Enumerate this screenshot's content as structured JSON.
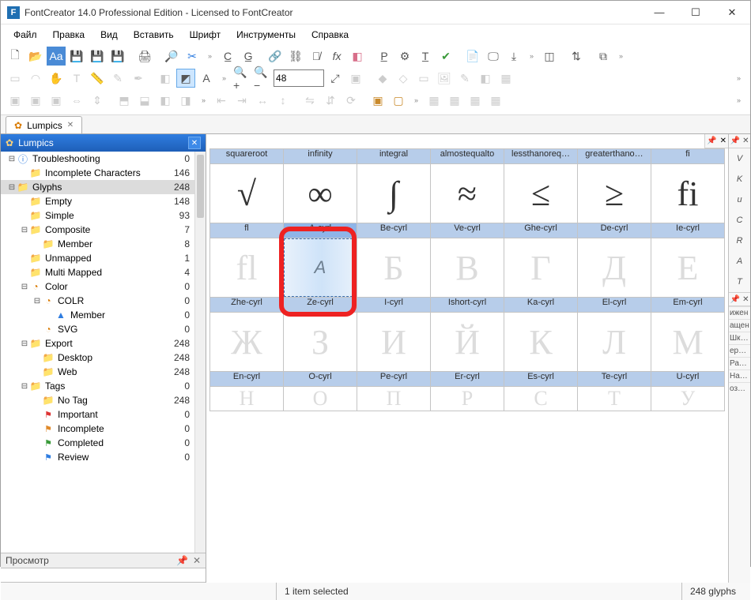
{
  "window": {
    "title": "FontCreator 14.0 Professional Edition - Licensed to FontCreator",
    "app_initial": "F"
  },
  "menu": {
    "items": [
      "Файл",
      "Правка",
      "Вид",
      "Вставить",
      "Шрифт",
      "Инструменты",
      "Справка"
    ]
  },
  "doc_tab": {
    "label": "Lumpics"
  },
  "left_panel": {
    "title": "Lumpics",
    "nodes": [
      {
        "depth": 0,
        "toggle": "-",
        "icon": "info",
        "label": "Troubleshooting",
        "count": 0
      },
      {
        "depth": 1,
        "toggle": "",
        "icon": "folder",
        "label": "Incomplete Characters",
        "count": 146
      },
      {
        "depth": 0,
        "toggle": "-",
        "icon": "folder",
        "label": "Glyphs",
        "count": 248,
        "selected": true
      },
      {
        "depth": 1,
        "toggle": "",
        "icon": "folder",
        "label": "Empty",
        "count": 148
      },
      {
        "depth": 1,
        "toggle": "",
        "icon": "folder",
        "label": "Simple",
        "count": 93
      },
      {
        "depth": 1,
        "toggle": "-",
        "icon": "folder",
        "label": "Composite",
        "count": 7
      },
      {
        "depth": 2,
        "toggle": "",
        "icon": "folder",
        "label": "Member",
        "count": 8
      },
      {
        "depth": 1,
        "toggle": "",
        "icon": "folder",
        "label": "Unmapped",
        "count": 1
      },
      {
        "depth": 1,
        "toggle": "",
        "icon": "folder",
        "label": "Multi Mapped",
        "count": 4
      },
      {
        "depth": 1,
        "toggle": "-",
        "icon": "pie",
        "label": "Color",
        "count": 0
      },
      {
        "depth": 2,
        "toggle": "-",
        "icon": "pie",
        "label": "COLR",
        "count": 0
      },
      {
        "depth": 3,
        "toggle": "",
        "icon": "tri",
        "label": "Member",
        "count": 0
      },
      {
        "depth": 2,
        "toggle": "",
        "icon": "pie",
        "label": "SVG",
        "count": 0
      },
      {
        "depth": 1,
        "toggle": "-",
        "icon": "folder",
        "label": "Export",
        "count": 248
      },
      {
        "depth": 2,
        "toggle": "",
        "icon": "folder",
        "label": "Desktop",
        "count": 248
      },
      {
        "depth": 2,
        "toggle": "",
        "icon": "folder",
        "label": "Web",
        "count": 248
      },
      {
        "depth": 1,
        "toggle": "-",
        "icon": "folder",
        "label": "Tags",
        "count": 0
      },
      {
        "depth": 2,
        "toggle": "",
        "icon": "folder",
        "label": "No Tag",
        "count": 248
      },
      {
        "depth": 2,
        "toggle": "",
        "icon": "flag-r",
        "label": "Important",
        "count": 0
      },
      {
        "depth": 2,
        "toggle": "",
        "icon": "flag-o",
        "label": "Incomplete",
        "count": 0
      },
      {
        "depth": 2,
        "toggle": "",
        "icon": "flag-g",
        "label": "Completed",
        "count": 0
      },
      {
        "depth": 2,
        "toggle": "",
        "icon": "flag-b",
        "label": "Review",
        "count": 0
      }
    ]
  },
  "grid": {
    "row1": {
      "heads": [
        "squareroot",
        "infinity",
        "integral",
        "almostequalto",
        "lessthanoreq…",
        "greaterthano…",
        "fi"
      ],
      "glyphs": [
        "√",
        "∞",
        "∫",
        "≈",
        "≤",
        "≥",
        "fi"
      ]
    },
    "row2": {
      "heads": [
        "fl",
        "A-cyrl",
        "Be-cyrl",
        "Ve-cyrl",
        "Ghe-cyrl",
        "De-cyrl",
        "Ie-cyrl"
      ],
      "glyphs": [
        "fl",
        "A",
        "Б",
        "В",
        "Г",
        "Д",
        "Е"
      ],
      "selected_col": 1
    },
    "row3": {
      "heads": [
        "Zhe-cyrl",
        "Ze-cyrl",
        "I-cyrl",
        "Ishort-cyrl",
        "Ka-cyrl",
        "El-cyrl",
        "Em-cyrl"
      ],
      "glyphs": [
        "Ж",
        "З",
        "И",
        "Й",
        "К",
        "Л",
        "М"
      ]
    },
    "row4": {
      "heads": [
        "En-cyrl",
        "O-cyrl",
        "Pe-cyrl",
        "Er-cyrl",
        "Es-cyrl",
        "Te-cyrl",
        "U-cyrl"
      ]
    }
  },
  "rightstrip": {
    "letters": [
      "V",
      "K",
      "u",
      "C",
      "R",
      "A",
      "T"
    ],
    "words": [
      "ижен",
      "ащен",
      "Шкал",
      "еркал",
      "Разме",
      "Накло",
      "озици"
    ]
  },
  "preview": {
    "label": "Просмотр"
  },
  "statusbar": {
    "selection": "1 item selected",
    "glyphs": "248 glyphs"
  },
  "zoom_value": "48"
}
